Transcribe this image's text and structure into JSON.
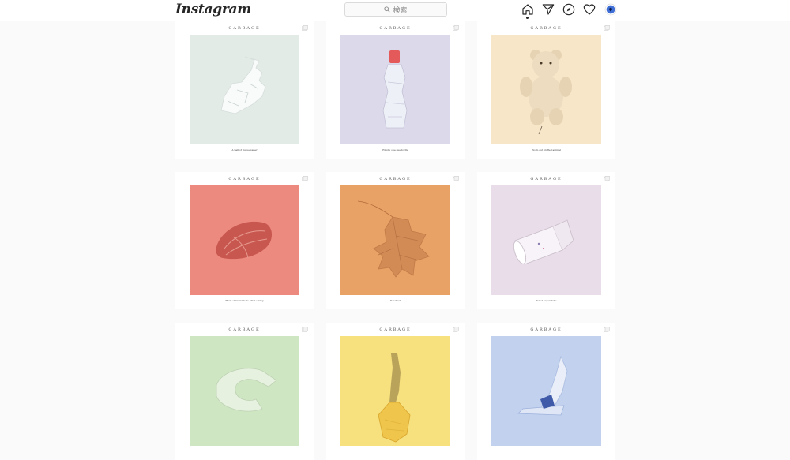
{
  "header": {
    "logo": "Instagram",
    "search_placeholder": "検索"
  },
  "nav": [
    "home-icon",
    "direct-icon",
    "explore-icon",
    "activity-icon",
    "profile-avatar"
  ],
  "colors": {
    "accent_avatar": "#3f6fd6"
  },
  "posts": [
    {
      "brand": "GARBAGE",
      "caption": "A ball of tissue paper",
      "bg": "#e3ebe7",
      "item": "tissue"
    },
    {
      "brand": "GARBAGE",
      "caption": "Empty one-use bottle",
      "bg": "#dcd9eb",
      "item": "bottle"
    },
    {
      "brand": "GARBAGE",
      "caption": "Worn-out stuffed animal",
      "bg": "#f7e6c8",
      "item": "bear"
    },
    {
      "brand": "GARBAGE",
      "caption": "Husk of Carambola after eating",
      "bg": "#ec8a80",
      "item": "husk"
    },
    {
      "brand": "GARBAGE",
      "caption": "Deadleaf",
      "bg": "#e8a266",
      "item": "leaf"
    },
    {
      "brand": "GARBAGE",
      "caption": "Toilet paper tube",
      "bg": "#e8dde8",
      "item": "tube"
    },
    {
      "brand": "GARBAGE",
      "caption": "",
      "bg": "#cfe6c3",
      "item": "peel"
    },
    {
      "brand": "GARBAGE",
      "caption": "",
      "bg": "#f7e07e",
      "item": "banana"
    },
    {
      "brand": "GARBAGE",
      "caption": "",
      "bg": "#c2d1ee",
      "item": "wrapper"
    }
  ]
}
